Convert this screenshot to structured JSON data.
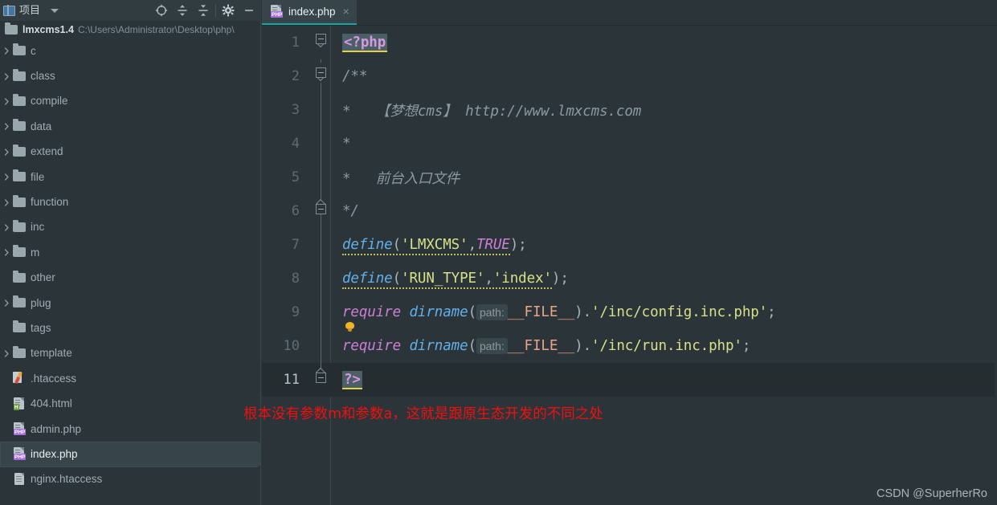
{
  "sidebar": {
    "panel_title": "项目",
    "toolbar_buttons": [
      {
        "name": "locate-icon",
        "label": "Select Opened File"
      },
      {
        "name": "expand-all-icon",
        "label": "Expand All"
      },
      {
        "name": "collapse-all-icon",
        "label": "Collapse All"
      },
      {
        "name": "gear-icon",
        "label": "Options"
      },
      {
        "name": "minimize-icon",
        "label": "Hide"
      }
    ],
    "root": {
      "name": "lmxcms1.4",
      "path": "C:\\Users\\Administrator\\Desktop\\php\\"
    },
    "items": [
      {
        "label": "c",
        "type": "folder",
        "expandable": true,
        "selected": false
      },
      {
        "label": "class",
        "type": "folder",
        "expandable": true,
        "selected": false
      },
      {
        "label": "compile",
        "type": "folder",
        "expandable": true,
        "selected": false
      },
      {
        "label": "data",
        "type": "folder",
        "expandable": true,
        "selected": false
      },
      {
        "label": "extend",
        "type": "folder",
        "expandable": true,
        "selected": false
      },
      {
        "label": "file",
        "type": "folder",
        "expandable": true,
        "selected": false
      },
      {
        "label": "function",
        "type": "folder",
        "expandable": true,
        "selected": false
      },
      {
        "label": "inc",
        "type": "folder",
        "expandable": true,
        "selected": false
      },
      {
        "label": "m",
        "type": "folder",
        "expandable": true,
        "selected": false
      },
      {
        "label": "other",
        "type": "folder",
        "expandable": false,
        "selected": false
      },
      {
        "label": "plug",
        "type": "folder",
        "expandable": true,
        "selected": false
      },
      {
        "label": "tags",
        "type": "folder",
        "expandable": false,
        "selected": false
      },
      {
        "label": "template",
        "type": "folder",
        "expandable": true,
        "selected": false
      },
      {
        "label": ".htaccess",
        "type": "htaccess",
        "expandable": false,
        "selected": false
      },
      {
        "label": "404.html",
        "type": "html",
        "expandable": false,
        "selected": false
      },
      {
        "label": "admin.php",
        "type": "php",
        "expandable": false,
        "selected": false
      },
      {
        "label": "index.php",
        "type": "php",
        "expandable": false,
        "selected": true
      },
      {
        "label": "nginx.htaccess",
        "type": "doc",
        "expandable": false,
        "selected": false
      }
    ]
  },
  "editor": {
    "tab": {
      "label": "index.php",
      "icon": "php-file-icon",
      "close_label": "×"
    },
    "lines": [
      {
        "num": "1",
        "current": false
      },
      {
        "num": "2",
        "current": false
      },
      {
        "num": "3",
        "current": false
      },
      {
        "num": "4",
        "current": false
      },
      {
        "num": "5",
        "current": false
      },
      {
        "num": "6",
        "current": false
      },
      {
        "num": "7",
        "current": false
      },
      {
        "num": "8",
        "current": false
      },
      {
        "num": "9",
        "current": false
      },
      {
        "num": "10",
        "current": false
      },
      {
        "num": "11",
        "current": true
      }
    ],
    "code": {
      "l1_php_open": "<?php",
      "l2_comment": "/**",
      "l3_star": "*",
      "l3_text": "【梦想cms】 http://www.lmxcms.com",
      "l4_star": "*",
      "l5_star": "*",
      "l5_text": "前台入口文件",
      "l6_comment": "*/",
      "l7_fn": "define",
      "l7_p1": "(",
      "l7_str1": "'LMXCMS'",
      "l7_comma": ",",
      "l7_const": "TRUE",
      "l7_p2": ");",
      "l8_fn": "define",
      "l8_p1": "(",
      "l8_str1": "'RUN_TYPE'",
      "l8_comma": ",",
      "l8_str2": "'index'",
      "l8_p2": ");",
      "l9_kw": "require",
      "l9_fn": "dirname",
      "l9_p1": "(",
      "l9_hint": "path:",
      "l9_magic": "__FILE__",
      "l9_p2": ").",
      "l9_str": "'/inc/config.inc.php'",
      "l9_semi": ";",
      "l10_kw": "require",
      "l10_fn": "dirname",
      "l10_p1": "(",
      "l10_hint": "path:",
      "l10_magic": "__FILE__",
      "l10_p2": ").",
      "l10_str": "'/inc/run.inc.php'",
      "l10_semi": ";",
      "l11_php_close": "?>"
    }
  },
  "annotations": {
    "red_note": "根本没有参数m和参数a，这就是跟原生态开发的不同之处",
    "watermark": "CSDN @SuperherRo"
  },
  "colors": {
    "background": "#2b3438",
    "panel": "#313c41",
    "tab_underline": "#1aa5a5",
    "selection": "#374449",
    "red_note": "#f01010",
    "string": "#d8e08a",
    "keyword": "#cc7fd4",
    "function": "#63b0e8",
    "magic_const": "#e8a48a"
  }
}
